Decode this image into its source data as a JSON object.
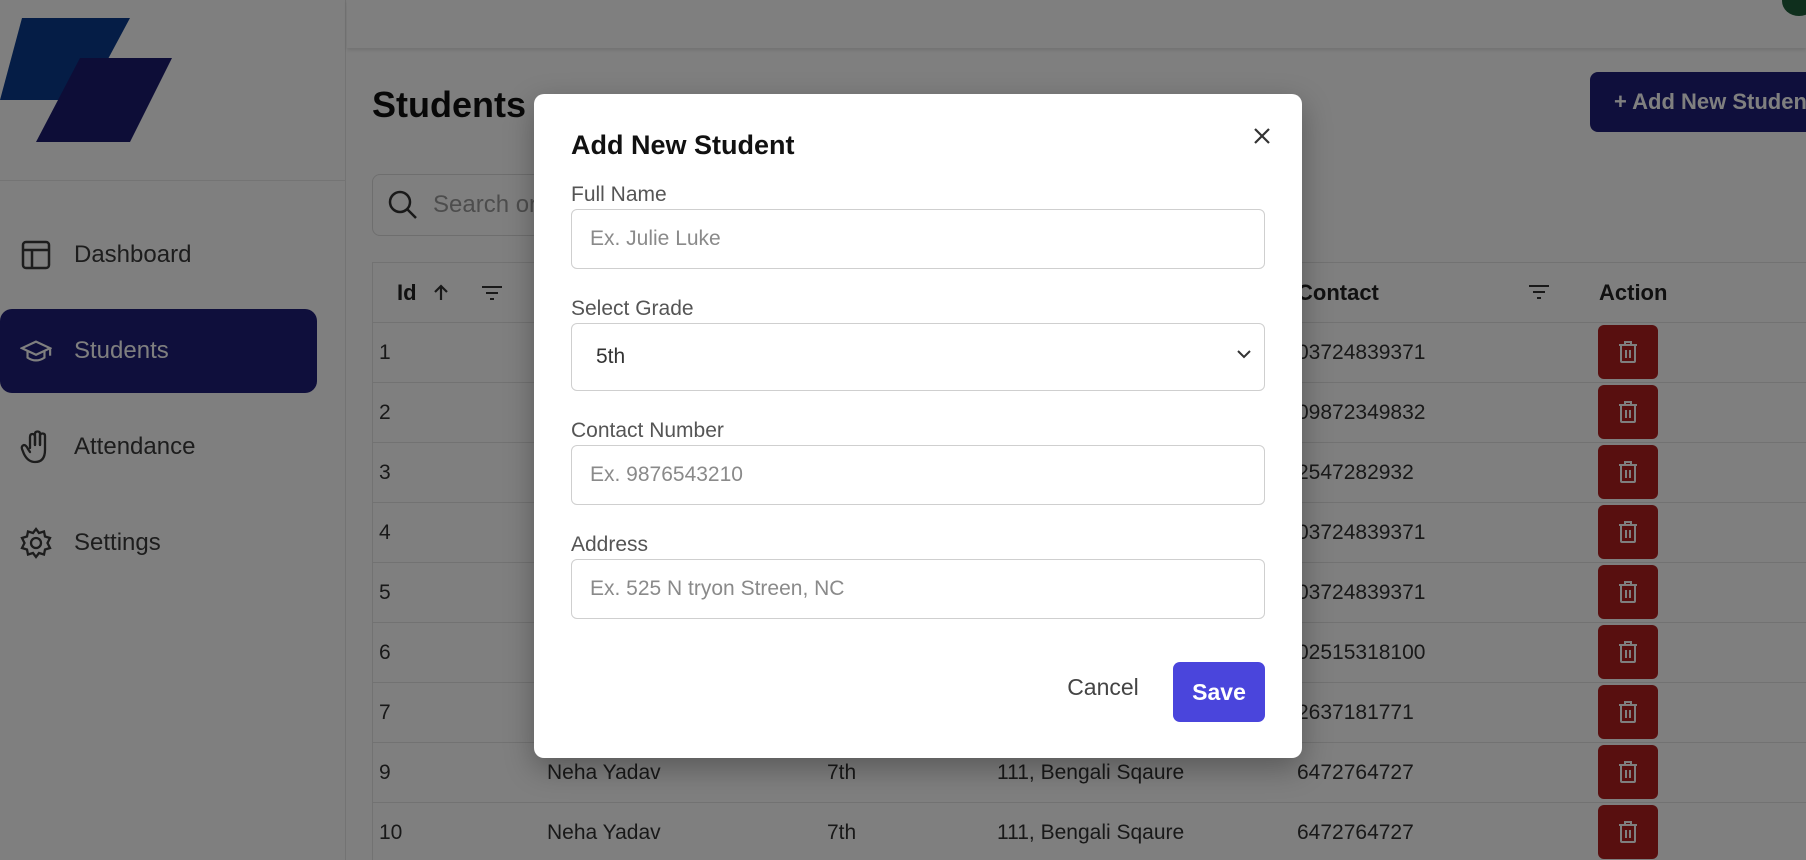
{
  "sidebar": {
    "items": [
      {
        "label": "Dashboard",
        "icon": "layout-icon"
      },
      {
        "label": "Students",
        "icon": "graduation-cap-icon"
      },
      {
        "label": "Attendance",
        "icon": "hand-icon"
      },
      {
        "label": "Settings",
        "icon": "gear-icon"
      }
    ]
  },
  "header": {
    "title": "Students",
    "add_button": "+ Add New Student",
    "search_placeholder": "Search on"
  },
  "table": {
    "columns": [
      "Id",
      "Contact",
      "Action"
    ],
    "rows": [
      {
        "id": "1",
        "name": "",
        "grade": "",
        "address": "",
        "contact": "03724839371"
      },
      {
        "id": "2",
        "name": "",
        "grade": "",
        "address": "",
        "contact": "09872349832"
      },
      {
        "id": "3",
        "name": "",
        "grade": "",
        "address": "",
        "contact": "2547282932"
      },
      {
        "id": "4",
        "name": "",
        "grade": "",
        "address": "",
        "contact": "03724839371"
      },
      {
        "id": "5",
        "name": "",
        "grade": "",
        "address": "",
        "contact": "03724839371"
      },
      {
        "id": "6",
        "name": "",
        "grade": "",
        "address": "",
        "contact": "02515318100"
      },
      {
        "id": "7",
        "name": "",
        "grade": "",
        "address": "",
        "contact": "2637181771"
      },
      {
        "id": "9",
        "name": "Neha Yadav",
        "grade": "7th",
        "address": "111, Bengali Sqaure",
        "contact": "6472764727"
      },
      {
        "id": "10",
        "name": "Neha Yadav",
        "grade": "7th",
        "address": "111, Bengali Sqaure",
        "contact": "6472764727"
      }
    ]
  },
  "modal": {
    "title": "Add New Student",
    "full_name": {
      "label": "Full Name",
      "placeholder": "Ex. Julie Luke"
    },
    "grade": {
      "label": "Select Grade",
      "value": "5th"
    },
    "contact": {
      "label": "Contact Number",
      "placeholder": "Ex. 9876543210"
    },
    "address": {
      "label": "Address",
      "placeholder": "Ex. 525 N tryon Streen, NC"
    },
    "cancel_label": "Cancel",
    "save_label": "Save"
  },
  "colors": {
    "brand": "#1e1e78",
    "save_button": "#4a45dc",
    "delete_button": "#b01e1e"
  }
}
